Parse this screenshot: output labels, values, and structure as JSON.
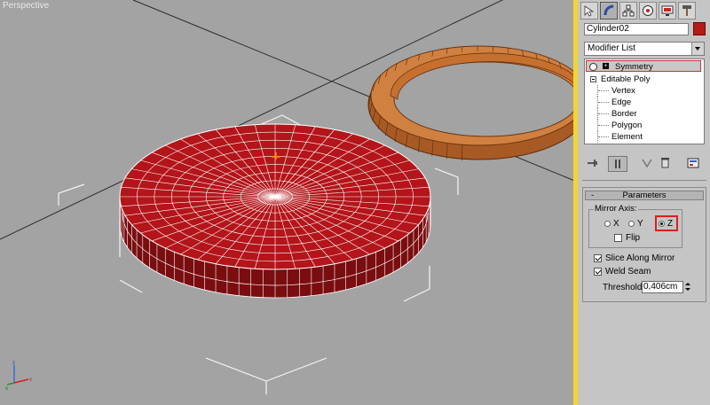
{
  "viewport": {
    "label": "Perspective"
  },
  "command_panel": {
    "tabs": [
      {
        "name": "create-tab",
        "icon": "create-arrow-icon"
      },
      {
        "name": "modify-tab",
        "icon": "modify-bend-icon"
      },
      {
        "name": "hierarchy-tab",
        "icon": "hierarchy-icon"
      },
      {
        "name": "motion-tab",
        "icon": "motion-icon"
      },
      {
        "name": "display-tab",
        "icon": "display-monitor-icon"
      },
      {
        "name": "utilities-tab",
        "icon": "utilities-hammer-icon"
      }
    ],
    "object_name": "Cylinder02",
    "object_color": "#b51c17",
    "modifier_list": "Modifier List",
    "stack": {
      "symmetry": "Symmetry",
      "editable_poly": "Editable Poly",
      "subobjects": [
        "Vertex",
        "Edge",
        "Border",
        "Polygon",
        "Element"
      ]
    }
  },
  "parameters": {
    "title": "Parameters",
    "collapse": "-",
    "mirror_axis_label": "Mirror Axis:",
    "axis_x": "X",
    "axis_y": "Y",
    "axis_z": "Z",
    "selected_axis": "Z",
    "flip": "Flip",
    "flip_checked": false,
    "slice_along_mirror": "Slice Along Mirror",
    "slice_checked": true,
    "weld_seam": "Weld Seam",
    "weld_checked": true,
    "threshold_label": "Threshold:",
    "threshold_value": "0,406cm"
  },
  "colors": {
    "active_viewport_border": "#f2d530",
    "highlight_red": "#dc2020",
    "disc_red": "#b3151a",
    "torus_orange": "#d08040"
  }
}
